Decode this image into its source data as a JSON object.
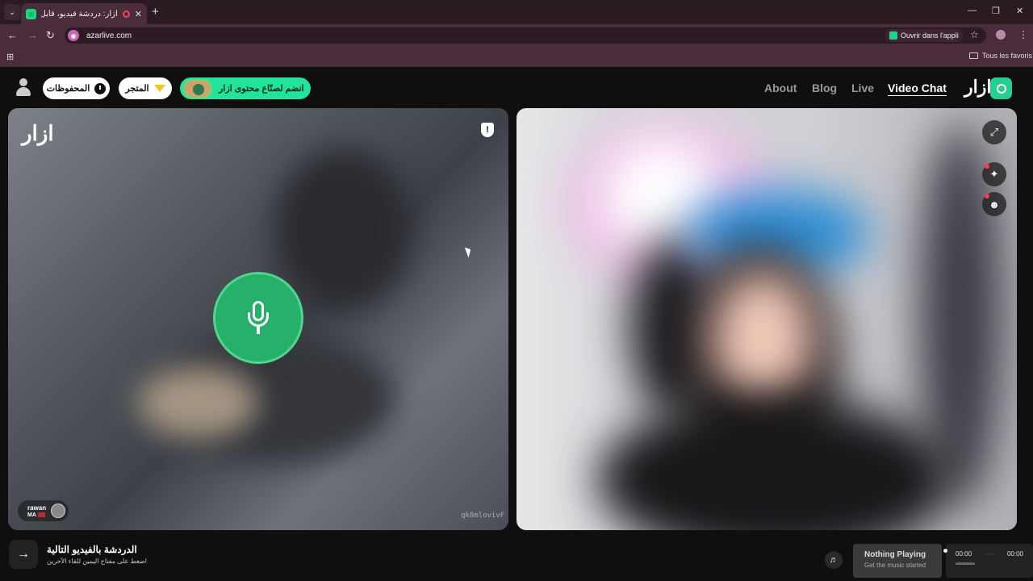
{
  "browser": {
    "tab_title": "أزار: دردشة فيديو، قابل الأصدقاء",
    "url": "azarlive.com",
    "open_app_label": "Ouvrir dans l'appli",
    "bookmarks_label": "Tous les favoris"
  },
  "nav": {
    "saved_label": "المحفوظات",
    "store_label": "المتجر",
    "creator_label": "انضم لصنّاع محتوى ازار",
    "links": [
      "About",
      "Blog",
      "Live",
      "Video Chat"
    ],
    "logo_text": "ازار"
  },
  "peer": {
    "watermark": "ازار",
    "name": "rawan",
    "country": "MA",
    "id": "qk8mlovivF"
  },
  "bottom": {
    "next_title": "الدردشة بالفيديو التالية",
    "next_subtitle": "اضغط على مفتاح اليمين للقاء الآخرين"
  },
  "music": {
    "title": "Nothing Playing",
    "subtitle": "Get the music started",
    "elapsed": "00:00",
    "total": "00:00"
  }
}
